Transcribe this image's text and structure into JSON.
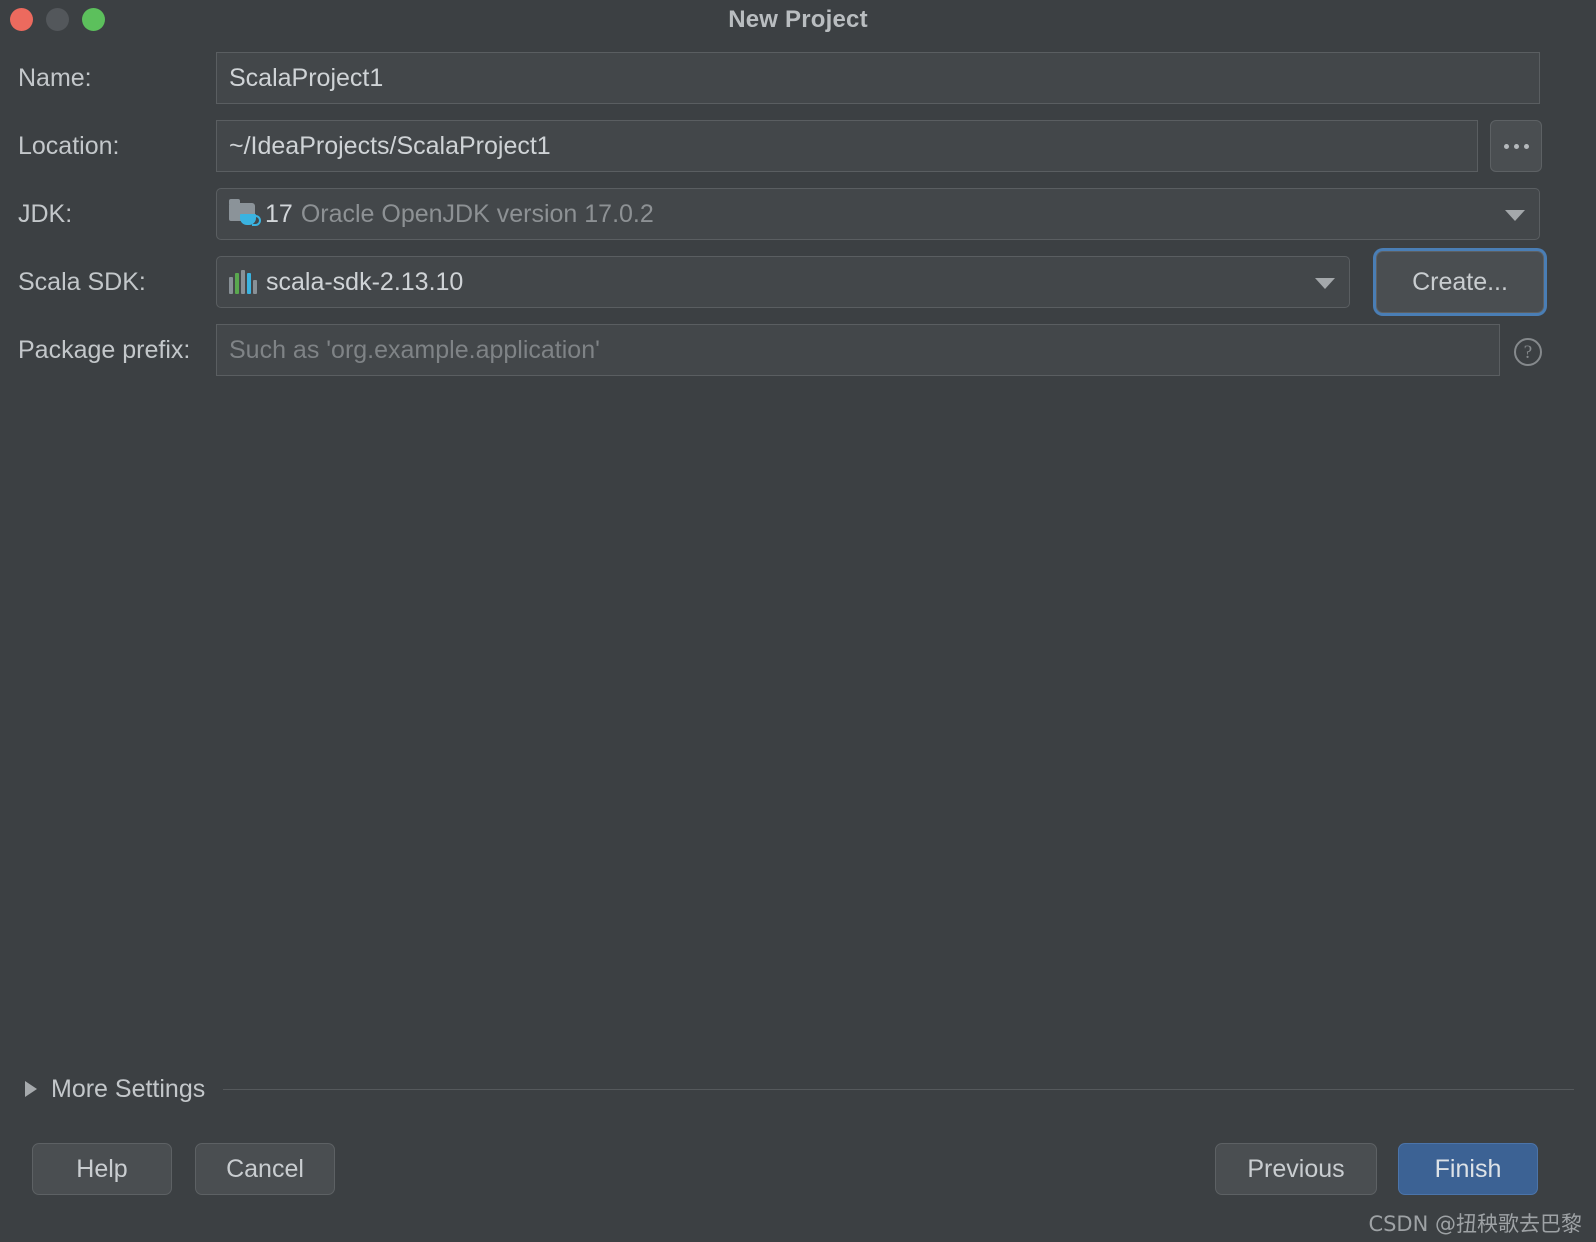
{
  "window": {
    "title": "New Project",
    "traffic_lights": [
      {
        "name": "close",
        "color": "#ec6a5e"
      },
      {
        "name": "minimize",
        "color": "#53575b"
      },
      {
        "name": "zoom",
        "color": "#5cc05c"
      }
    ]
  },
  "form": {
    "name": {
      "label": "Name:",
      "value": "ScalaProject1",
      "placeholder": ""
    },
    "location": {
      "label": "Location:",
      "value": "~/IdeaProjects/ScalaProject1",
      "placeholder": "",
      "browse_label": "..."
    },
    "jdk": {
      "label": "JDK:",
      "icon": "jdk-folder-coffee-icon",
      "version": "17",
      "description": "Oracle OpenJDK version 17.0.2"
    },
    "scala_sdk": {
      "label": "Scala SDK:",
      "icon": "scala-bars-icon",
      "value": "scala-sdk-2.13.10",
      "create_label": "Create..."
    },
    "package_prefix": {
      "label": "Package prefix:",
      "value": "",
      "placeholder": "Such as 'org.example.application'",
      "help_label": "?"
    }
  },
  "more_settings": {
    "label": "More Settings",
    "expanded": false,
    "arrow_icon": "chevron-right-icon"
  },
  "footer": {
    "help": "Help",
    "cancel": "Cancel",
    "previous": "Previous",
    "finish": "Finish"
  },
  "watermark": {
    "text": "CSDN @扭秧歌去巴黎"
  },
  "colors": {
    "background": "#3c4043",
    "field_background": "#43474a",
    "field_border": "#5a5e61",
    "button_background": "#4a4e51",
    "accent_blue": "#3c6294",
    "focus_ring": "#4a7eb5",
    "text": "#c3c7ca",
    "text_dim": "#8d9194"
  }
}
